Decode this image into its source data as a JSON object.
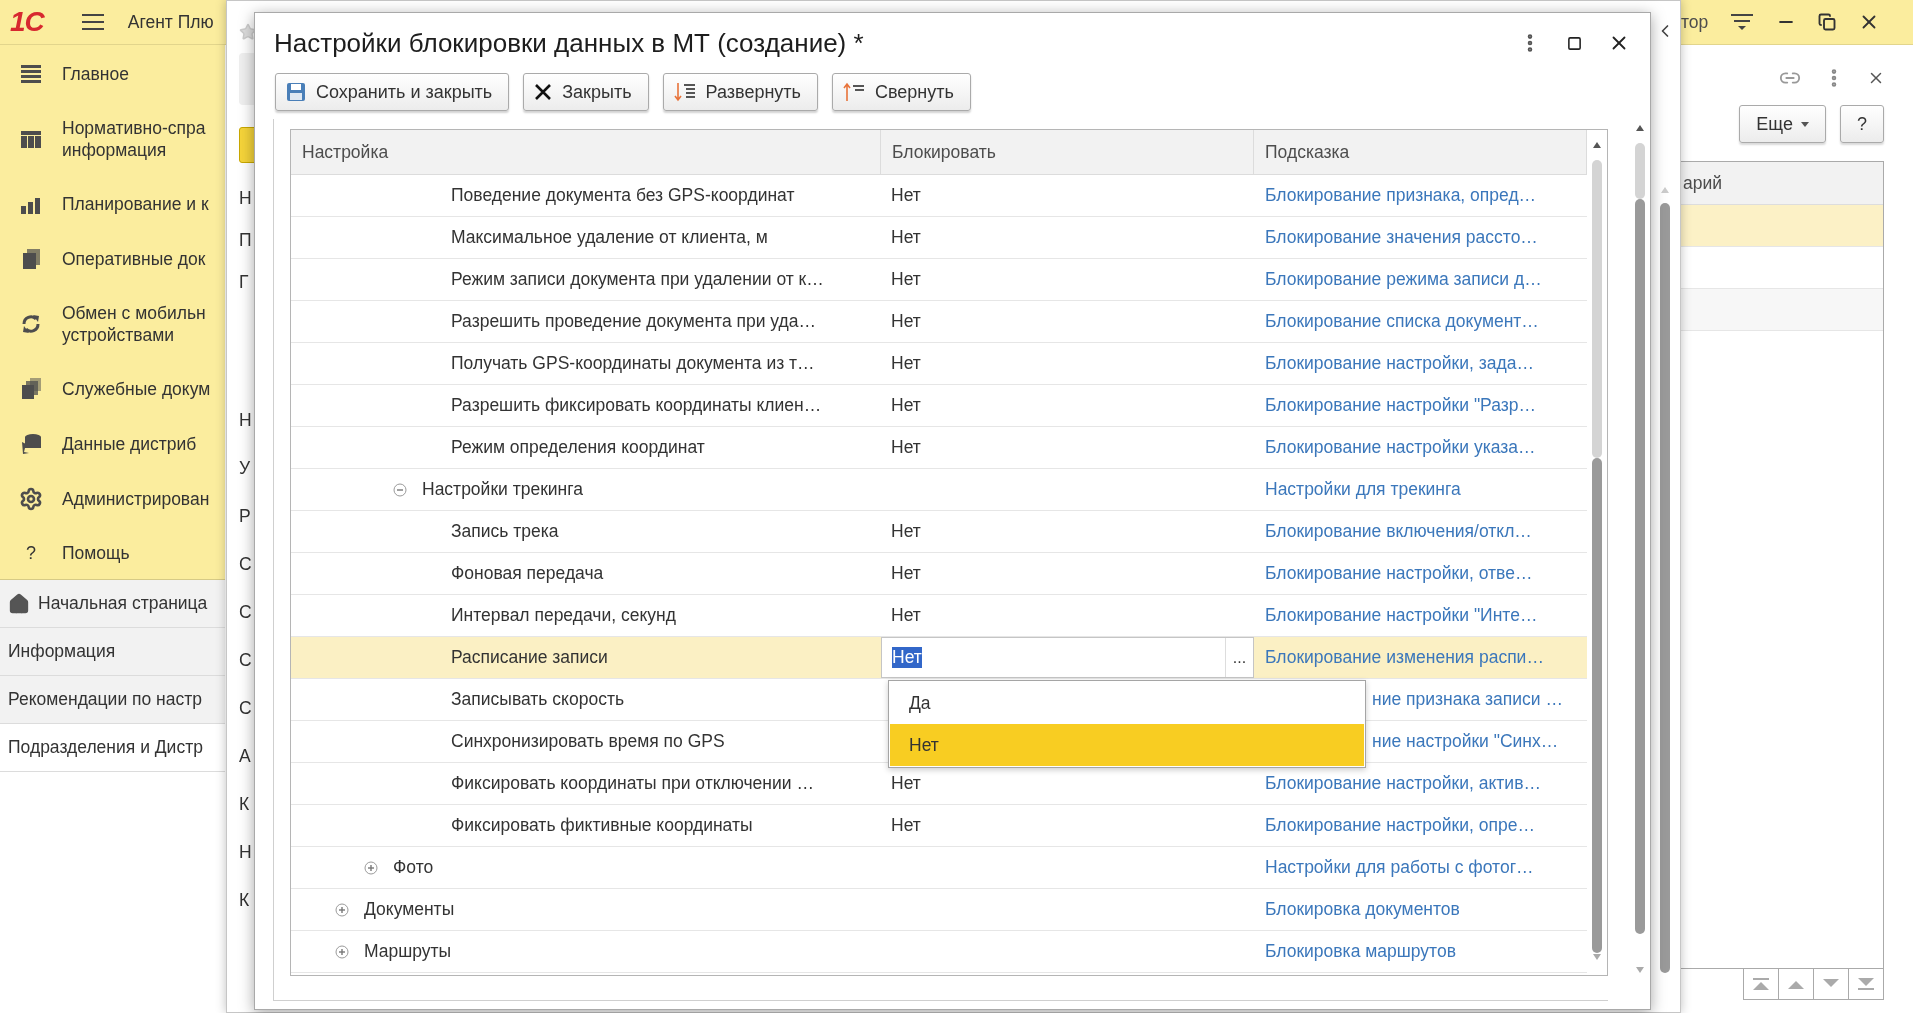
{
  "app": {
    "logo": "1С",
    "title": "Агент Плю",
    "right_title": "тор"
  },
  "sidebar": {
    "sections": [
      {
        "label": "Главное"
      },
      {
        "label": "Нормативно-спра\nинформация"
      },
      {
        "label": "Планирование и к"
      },
      {
        "label": "Оперативные док"
      },
      {
        "label": "Обмен с мобильн\nустройствами"
      },
      {
        "label": "Служебные докум"
      },
      {
        "label": "Данные дистриб"
      },
      {
        "label": "Администрирован"
      },
      {
        "glyph": "?",
        "label": "Помощь"
      }
    ],
    "open_pages": [
      {
        "label": "Начальная страница",
        "home": true,
        "selected": false
      },
      {
        "label": "Информация",
        "selected": false
      },
      {
        "label": "Рекомендации по настр",
        "selected": false
      },
      {
        "label": "Подразделения и Дистр",
        "selected": true
      }
    ]
  },
  "background_form": {
    "letters_top": [
      "Н",
      "П",
      "Г"
    ],
    "letters_bottom": [
      "Н",
      "У",
      "Р",
      "С",
      "С",
      "С",
      "С",
      "А",
      "К",
      "Н",
      "К"
    ]
  },
  "dialog": {
    "title": "Настройки блокировки данных в МТ (создание) *",
    "buttons": [
      {
        "kind": "save",
        "label": "Сохранить и закрыть"
      },
      {
        "kind": "close",
        "label": "Закрыть"
      },
      {
        "kind": "expand",
        "label": "Развернуть"
      },
      {
        "kind": "collapse",
        "label": "Свернуть"
      }
    ],
    "table": {
      "columns": [
        "Настройка",
        "Блокировать",
        "Подсказка"
      ],
      "rows": [
        {
          "children": [
            {
              "children": [
                {
                  "children": [
                    {
                      "label": "Поведение документа без GPS-координат",
                      "value": "Нет",
                      "hint": "Блокирование признака, опред…",
                      "selected": false
                    },
                    {
                      "label": "Максимальное удаление от клиента, м",
                      "value": "Нет",
                      "hint": "Блокирование значения рассто…",
                      "selected": false
                    },
                    {
                      "label": "Режим записи документа при удалении от к…",
                      "value": "Нет",
                      "hint": "Блокирование режима записи д…",
                      "selected": false
                    },
                    {
                      "label": "Разрешить проведение документа при уда…",
                      "value": "Нет",
                      "hint": "Блокирование списка документ…",
                      "selected": false
                    },
                    {
                      "label": "Получать GPS-координаты документа из т…",
                      "value": "Нет",
                      "hint": "Блокирование настройки, зада…",
                      "selected": false
                    },
                    {
                      "label": "Разрешить фиксировать координаты клиен…",
                      "value": "Нет",
                      "hint": "Блокирование настройки \"Разр…",
                      "selected": false
                    },
                    {
                      "label": "Режим определения координат",
                      "value": "Нет",
                      "hint": "Блокирование настройки указа…",
                      "selected": false
                    }
                  ]
                },
                {
                  "label": "Настройки трекинга",
                  "hint": "Настройки для трекинга",
                  "expanded": true,
                  "selected": false,
                  "children": [
                    {
                      "label": "Запись трека",
                      "value": "Нет",
                      "hint": "Блокирование включения/откл…",
                      "selected": false
                    },
                    {
                      "label": "Фоновая передача",
                      "value": "Нет",
                      "hint": "Блокирование настройки, отве…",
                      "selected": false
                    },
                    {
                      "label": "Интервал передачи, секунд",
                      "value": "Нет",
                      "hint": "Блокирование настройки \"Инте…",
                      "selected": false
                    },
                    {
                      "label": "Расписание записи",
                      "value": "Нет",
                      "editor_button": "...",
                      "hint": "Блокирование изменения распи…",
                      "selected": true
                    },
                    {
                      "label": "Записывать скорость",
                      "hint": "ние признака записи …",
                      "obscured": true,
                      "selected": false
                    },
                    {
                      "label": "Синхронизировать время по GPS",
                      "hint": "ние настройки \"Синх…",
                      "obscured": true,
                      "selected": false
                    },
                    {
                      "label": "Фиксировать координаты при отключении …",
                      "value": "Нет",
                      "hint": "Блокирование настройки, актив…",
                      "selected": false
                    },
                    {
                      "label": "Фиксировать фиктивные координаты",
                      "value": "Нет",
                      "hint": "Блокирование настройки, опре…",
                      "selected": false
                    }
                  ]
                }
              ]
            },
            {
              "label": "Фото",
              "hint": "Настройки для работы с фотог…",
              "expanded": false,
              "selected": false
            }
          ]
        },
        {
          "label": "Документы",
          "hint": "Блокировка документов",
          "expanded": false,
          "selected": false
        },
        {
          "label": "Маршруты",
          "hint": "Блокировка маршрутов",
          "expanded": false,
          "selected": false
        }
      ]
    },
    "dropdown": {
      "options": [
        {
          "label": "Да",
          "selected": false
        },
        {
          "label": "Нет",
          "selected": true
        }
      ]
    }
  },
  "right_panel": {
    "more_button": "Еще",
    "help_button": "?",
    "column_header": "арий",
    "rows": [
      {
        "selected": true
      },
      {
        "selected": false
      },
      {
        "selected": false
      }
    ]
  }
}
